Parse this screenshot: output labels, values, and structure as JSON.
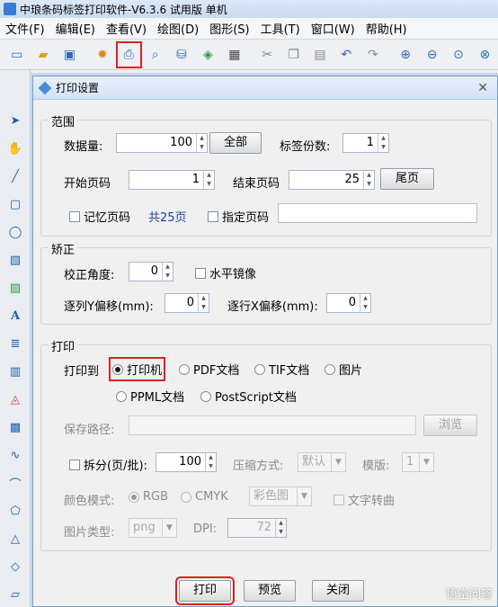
{
  "app": {
    "title": "中琅条码标签打印软件-V6.3.6 试用版 单机",
    "menu": [
      "文件(F)",
      "编辑(E)",
      "查看(V)",
      "绘图(D)",
      "图形(S)",
      "工具(T)",
      "窗口(W)",
      "帮助(H)"
    ]
  },
  "dialog": {
    "title": "打印设置",
    "range": {
      "legend": "范围",
      "data_count_label": "数据量:",
      "data_count_value": "100",
      "all_button": "全部",
      "copies_label": "标签份数:",
      "copies_value": "1",
      "start_page_label": "开始页码",
      "start_page_value": "1",
      "end_page_label": "结束页码",
      "end_page_value": "25",
      "last_page_button": "尾页",
      "remember_page_label": "记忆页码",
      "total_pages": "共25页",
      "specify_page_label": "指定页码"
    },
    "correction": {
      "legend": "矫正",
      "angle_label": "校正角度:",
      "angle_value": "0",
      "mirror_label": "水平镜像",
      "col_y_offset_label": "逐列Y偏移(mm):",
      "col_y_offset_value": "0",
      "row_x_offset_label": "逐行X偏移(mm):",
      "row_x_offset_value": "0"
    },
    "print": {
      "legend": "打印",
      "print_to_label": "打印到",
      "targets": [
        "打印机",
        "PDF文档",
        "TIF文档",
        "图片",
        "PPML文档",
        "PostScript文档"
      ],
      "save_path_label": "保存路径:",
      "browse_button": "浏览",
      "split_label": "拆分(页/批):",
      "split_value": "100",
      "compress_label": "压缩方式:",
      "compress_value": "默认",
      "template_label": "模版:",
      "template_value": "1",
      "color_mode_label": "颜色模式:",
      "color_rgb": "RGB",
      "color_cmyk": "CMYK",
      "color_image_value": "彩色图",
      "text_convert_label": "文字转曲",
      "image_type_label": "图片类型:",
      "image_type_value": "png",
      "dpi_label": "DPI:",
      "dpi_value": "72"
    },
    "buttons": {
      "print": "打印",
      "preview": "预览",
      "close": "关闭"
    }
  },
  "watermark": "悟空问答",
  "colors": {
    "highlight": "#e02020",
    "accent": "#1c3fb0"
  }
}
